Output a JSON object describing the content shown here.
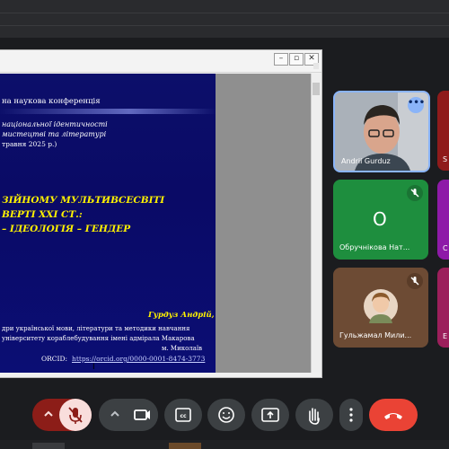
{
  "slide": {
    "line1": "на наукова конференція",
    "line2": "національної ідентичності",
    "line3": "мистецтві та літературі",
    "line4": "травня 2025 р.)",
    "title1": "ЗІЙНОМУ МУЛЬТИВСЕСВІТІ",
    "title2": "ВЕРТІ ХХІ СТ.:",
    "title3": "– ІДЕОЛОГІЯ – ГЕНДЕР",
    "author": "Гурдуз Андрій,",
    "aff1": "дри  української мови, літератури та методики навчання",
    "aff2": "університету кораблебудування імені адмірала Макарова",
    "aff3": "м. Миколаїв",
    "orcid_label": "ORCID:",
    "orcid_link": "https://orcid.org/0000-0001-8474-3773"
  },
  "participants": [
    {
      "name": "Andrii Gurduz",
      "avatar": ""
    },
    {
      "name": "Обручнікова Нат...",
      "avatar": "О"
    },
    {
      "name": "Гульжамал Мили...",
      "avatar": ""
    }
  ],
  "side_letters": [
    "S",
    "С",
    "Е"
  ],
  "colors": {
    "end_call": "#ea4335",
    "mic_off": "#f9dedc",
    "arrow_bg": "#8c1d18"
  }
}
